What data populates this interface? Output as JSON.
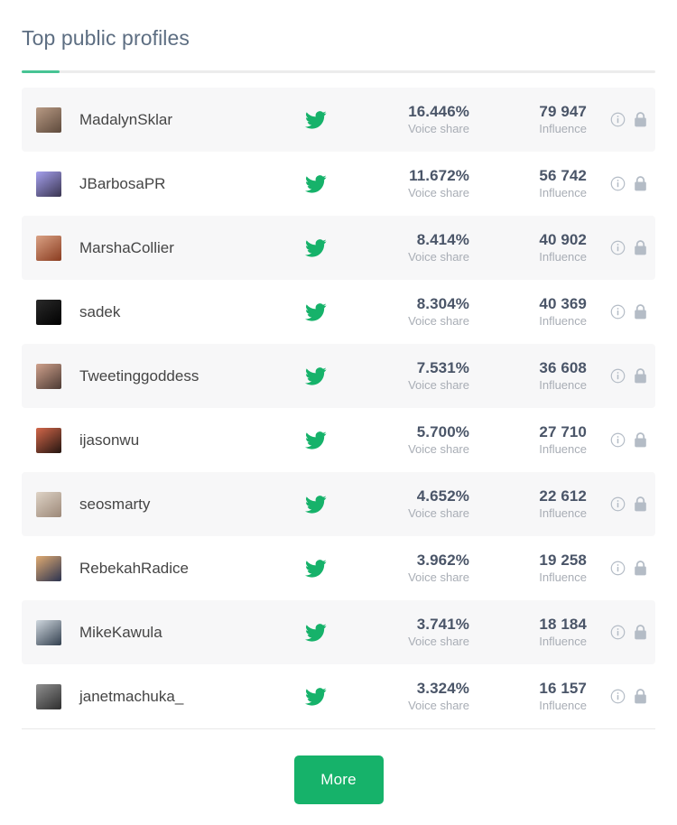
{
  "header": {
    "title": "Top public profiles",
    "accent_color": "#47c494",
    "rule_color": "#ececec"
  },
  "table": {
    "voice_label": "Voice share",
    "influence_label": "Influence",
    "network_icon": "twitter-icon",
    "network_icon_color": "#16b26a",
    "info_icon": "info-circle-icon",
    "lock_icon": "lock-icon",
    "icon_color": "#b4bcc6",
    "rows": [
      {
        "username": "MadalynSklar",
        "voice_share": "16.446%",
        "influence": "79 947",
        "avatar_colors": [
          "#b89a84",
          "#5e4a3c"
        ]
      },
      {
        "username": "JBarbosaPR",
        "voice_share": "11.672%",
        "influence": "56 742",
        "avatar_colors": [
          "#a5a0ee",
          "#3a3550"
        ]
      },
      {
        "username": "MarshaCollier",
        "voice_share": "8.414%",
        "influence": "40 902",
        "avatar_colors": [
          "#d9a184",
          "#8a3c20"
        ]
      },
      {
        "username": "sadek",
        "voice_share": "8.304%",
        "influence": "40 369",
        "avatar_colors": [
          "#2a2a2a",
          "#000000"
        ]
      },
      {
        "username": "Tweetinggoddess",
        "voice_share": "7.531%",
        "influence": "36 608",
        "avatar_colors": [
          "#cfa18c",
          "#4c3a33"
        ]
      },
      {
        "username": "ijasonwu",
        "voice_share": "5.700%",
        "influence": "27 710",
        "avatar_colors": [
          "#d2674a",
          "#241510"
        ]
      },
      {
        "username": "seosmarty",
        "voice_share": "4.652%",
        "influence": "22 612",
        "avatar_colors": [
          "#ded3c6",
          "#9c8878"
        ]
      },
      {
        "username": "RebekahRadice",
        "voice_share": "3.962%",
        "influence": "19 258",
        "avatar_colors": [
          "#e0ab72",
          "#2b3350"
        ]
      },
      {
        "username": "MikeKawula",
        "voice_share": "3.741%",
        "influence": "18 184",
        "avatar_colors": [
          "#cfd7de",
          "#33404f"
        ]
      },
      {
        "username": "janetmachuka_",
        "voice_share": "3.324%",
        "influence": "16 157",
        "avatar_colors": [
          "#8f8f8f",
          "#2e2e2e"
        ]
      }
    ]
  },
  "footer": {
    "more_label": "More",
    "more_color": "#16b26a"
  }
}
